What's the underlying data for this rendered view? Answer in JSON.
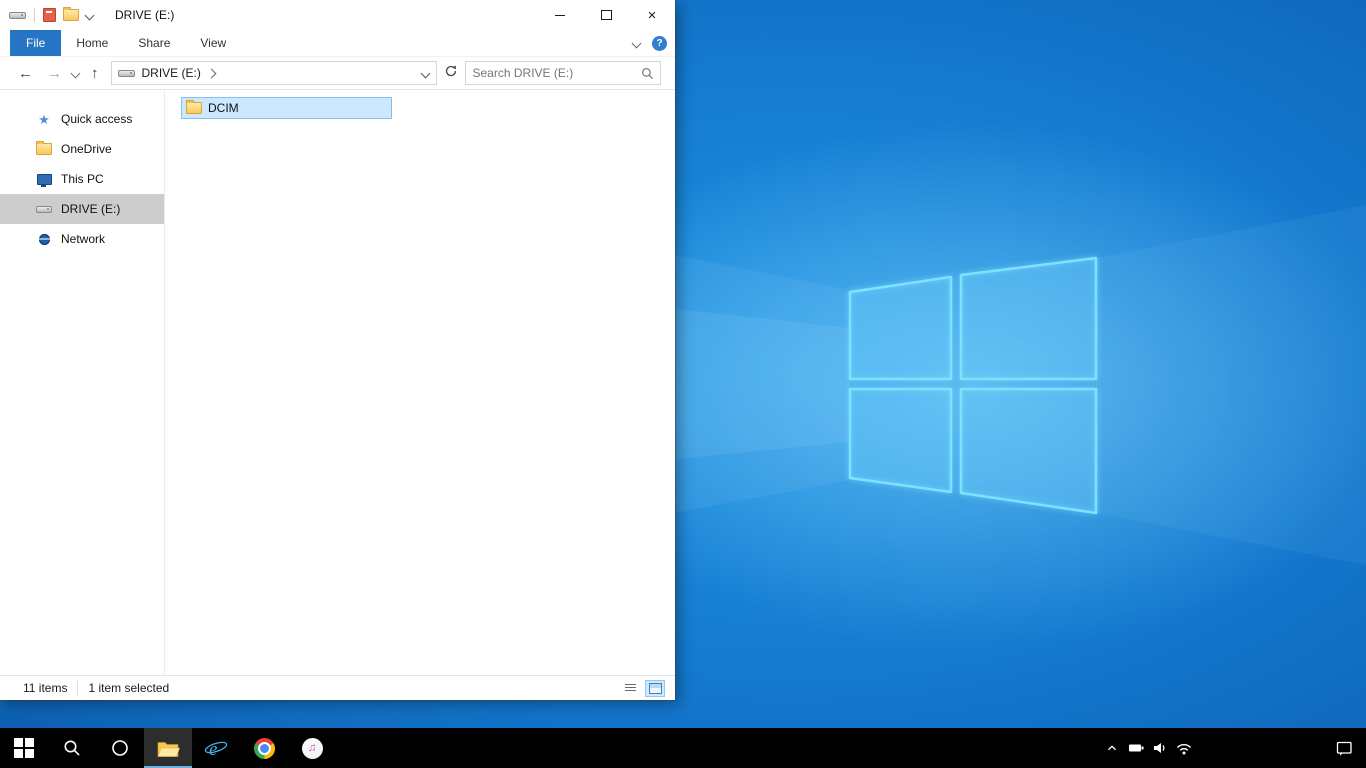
{
  "explorer": {
    "title": "DRIVE (E:)",
    "ribbon": {
      "tabs": [
        {
          "label": "File",
          "active": true
        },
        {
          "label": "Home",
          "active": false
        },
        {
          "label": "Share",
          "active": false
        },
        {
          "label": "View",
          "active": false
        }
      ]
    },
    "address": {
      "crumbs": [
        {
          "label": "DRIVE (E:)"
        }
      ]
    },
    "search": {
      "placeholder": "Search DRIVE (E:)"
    },
    "sidebar": {
      "items": [
        {
          "label": "Quick access",
          "icon": "star-icon",
          "selected": false
        },
        {
          "label": "OneDrive",
          "icon": "folder-icon",
          "selected": false
        },
        {
          "label": "This PC",
          "icon": "computer-icon",
          "selected": false
        },
        {
          "label": "DRIVE (E:)",
          "icon": "drive-icon",
          "selected": true
        },
        {
          "label": "Network",
          "icon": "network-icon",
          "selected": false
        }
      ]
    },
    "files": {
      "items": [
        {
          "name": "DCIM",
          "icon": "folder-icon",
          "selected": true
        }
      ]
    },
    "status": {
      "items_count": "11 items",
      "selected_count": "1 item selected",
      "view_buttons": [
        "details-view",
        "large-icons-view"
      ]
    },
    "qat_icons": [
      "drive-icon",
      "properties-icon",
      "new-folder-icon",
      "customize-chevron-icon"
    ],
    "window_controls": [
      "minimize",
      "maximize",
      "close"
    ]
  },
  "taskbar": {
    "items": [
      {
        "name": "start",
        "icon": "windows-logo-icon",
        "active": false
      },
      {
        "name": "search",
        "icon": "search-icon",
        "active": false
      },
      {
        "name": "cortana",
        "icon": "cortana-circle-icon",
        "active": false
      },
      {
        "name": "file-explorer",
        "icon": "folder-icon",
        "active": true
      },
      {
        "name": "internet-explorer",
        "icon": "ie-icon",
        "active": false
      },
      {
        "name": "chrome",
        "icon": "chrome-icon",
        "active": false
      },
      {
        "name": "itunes",
        "icon": "music-note-icon",
        "active": false
      }
    ],
    "tray": [
      {
        "name": "hidden-icons",
        "icon": "chevron-up-icon"
      },
      {
        "name": "battery",
        "icon": "battery-icon"
      },
      {
        "name": "volume",
        "icon": "speaker-icon"
      },
      {
        "name": "network",
        "icon": "wifi-icon"
      }
    ],
    "action_center": {
      "name": "action-center",
      "icon": "notification-icon"
    }
  },
  "colors": {
    "accent_blue": "#2674c4",
    "selection_bg": "#cce8ff",
    "selection_border": "#84c0ea",
    "sidebar_selected": "#cdcdcd",
    "taskbar_bg": "#000000",
    "active_underline": "#6cb2e8",
    "wallpaper_primary": "#1479cf"
  }
}
